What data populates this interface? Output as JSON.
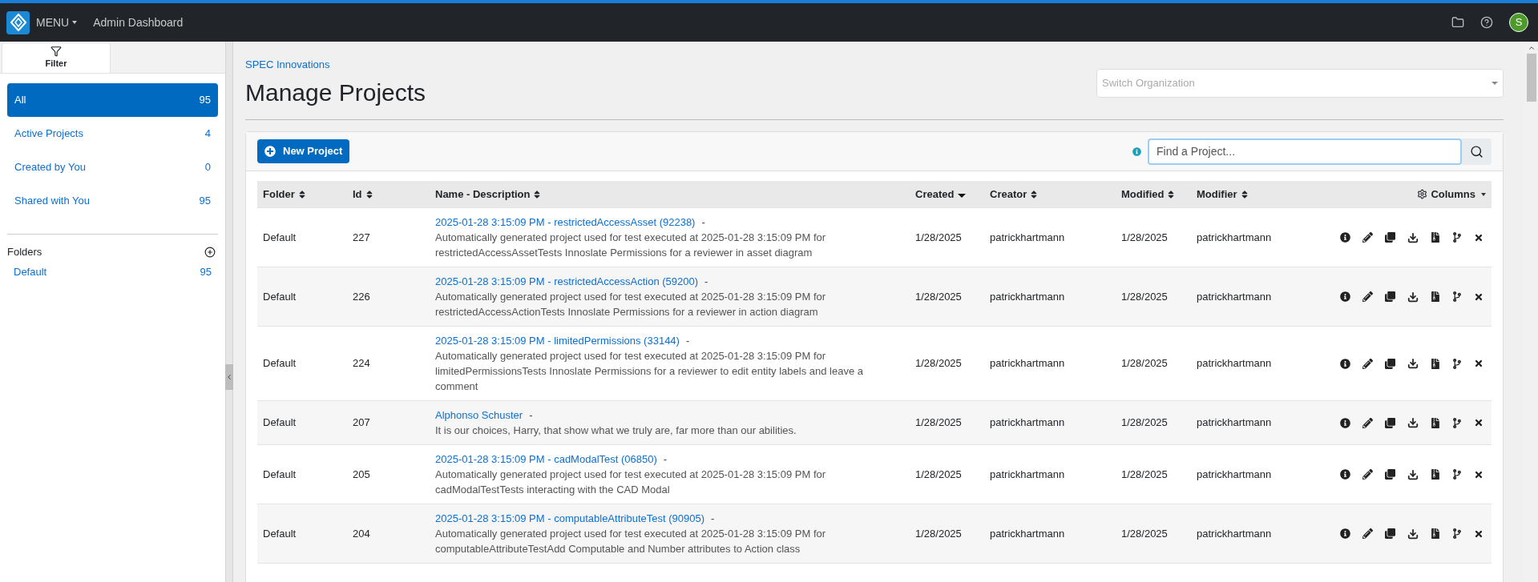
{
  "topbar": {
    "menu": "MENU",
    "title": "Admin Dashboard",
    "avatar": "S"
  },
  "sidebar": {
    "tab": "Filter",
    "filters": [
      {
        "label": "All",
        "count": "95",
        "selected": true
      },
      {
        "label": "Active Projects",
        "count": "4",
        "selected": false
      },
      {
        "label": "Created by You",
        "count": "0",
        "selected": false
      },
      {
        "label": "Shared with You",
        "count": "95",
        "selected": false
      }
    ],
    "folders_title": "Folders",
    "folders": [
      {
        "label": "Default",
        "count": "95"
      }
    ]
  },
  "breadcrumb": "SPEC Innovations",
  "heading": "Manage Projects",
  "org_select": {
    "placeholder": "Switch Organization"
  },
  "new_project": "New Project",
  "search": {
    "placeholder": "Find a Project..."
  },
  "table": {
    "columns": [
      {
        "label": "Folder",
        "sorted": false
      },
      {
        "label": "Id",
        "sorted": false
      },
      {
        "label": "Name - Description",
        "sorted": false
      },
      {
        "label": "Created",
        "sorted": true
      },
      {
        "label": "Creator",
        "sorted": false
      },
      {
        "label": "Modified",
        "sorted": false
      },
      {
        "label": "Modifier",
        "sorted": false
      }
    ],
    "columns_menu": "Columns",
    "rows": [
      {
        "folder": "Default",
        "id": "227",
        "title": {
          "name": "2025-01-28 3:15:09 PM - restrictedAccessAsset (92238)",
          "suffix": "-"
        },
        "description": "Automatically generated project used for test executed at 2025-01-28 3:15:09 PM for restrictedAccessAssetTests Innoslate Permissions for a reviewer in asset diagram",
        "created": "1/28/2025",
        "creator": "patrickhartmann",
        "modified": "1/28/2025",
        "modifier": "patrickhartmann"
      },
      {
        "folder": "Default",
        "id": "226",
        "title": {
          "name": "2025-01-28 3:15:09 PM - restrictedAccessAction (59200)",
          "suffix": "-"
        },
        "description": "Automatically generated project used for test executed at 2025-01-28 3:15:09 PM for restrictedAccessActionTests Innoslate Permissions for a reviewer in action diagram",
        "created": "1/28/2025",
        "creator": "patrickhartmann",
        "modified": "1/28/2025",
        "modifier": "patrickhartmann"
      },
      {
        "folder": "Default",
        "id": "224",
        "title": {
          "name": "2025-01-28 3:15:09 PM - limitedPermissions (33144)",
          "suffix": "-"
        },
        "description": "Automatically generated project used for test executed at 2025-01-28 3:15:09 PM for limitedPermissionsTests Innoslate Permissions for a reviewer to edit entity labels and leave a comment",
        "created": "1/28/2025",
        "creator": "patrickhartmann",
        "modified": "1/28/2025",
        "modifier": "patrickhartmann"
      },
      {
        "folder": "Default",
        "id": "207",
        "title": {
          "name": "Alphonso Schuster",
          "suffix": "-"
        },
        "description": "It is our choices, Harry, that show what we truly are, far more than our abilities.",
        "created": "1/28/2025",
        "creator": "patrickhartmann",
        "modified": "1/28/2025",
        "modifier": "patrickhartmann"
      },
      {
        "folder": "Default",
        "id": "205",
        "title": {
          "name": "2025-01-28 3:15:09 PM - cadModalTest (06850)",
          "suffix": "-"
        },
        "description": "Automatically generated project used for test executed at 2025-01-28 3:15:09 PM for cadModalTestTests interacting with the CAD Modal",
        "created": "1/28/2025",
        "creator": "patrickhartmann",
        "modified": "1/28/2025",
        "modifier": "patrickhartmann"
      },
      {
        "folder": "Default",
        "id": "204",
        "title": {
          "name": "2025-01-28 3:15:09 PM - computableAttributeTest (90905)",
          "suffix": "-"
        },
        "description": "Automatically generated project used for test executed at 2025-01-28 3:15:09 PM for computableAttributeTestAdd Computable and Number attributes to Action class",
        "created": "1/28/2025",
        "creator": "patrickhartmann",
        "modified": "1/28/2025",
        "modifier": "patrickhartmann"
      }
    ]
  }
}
